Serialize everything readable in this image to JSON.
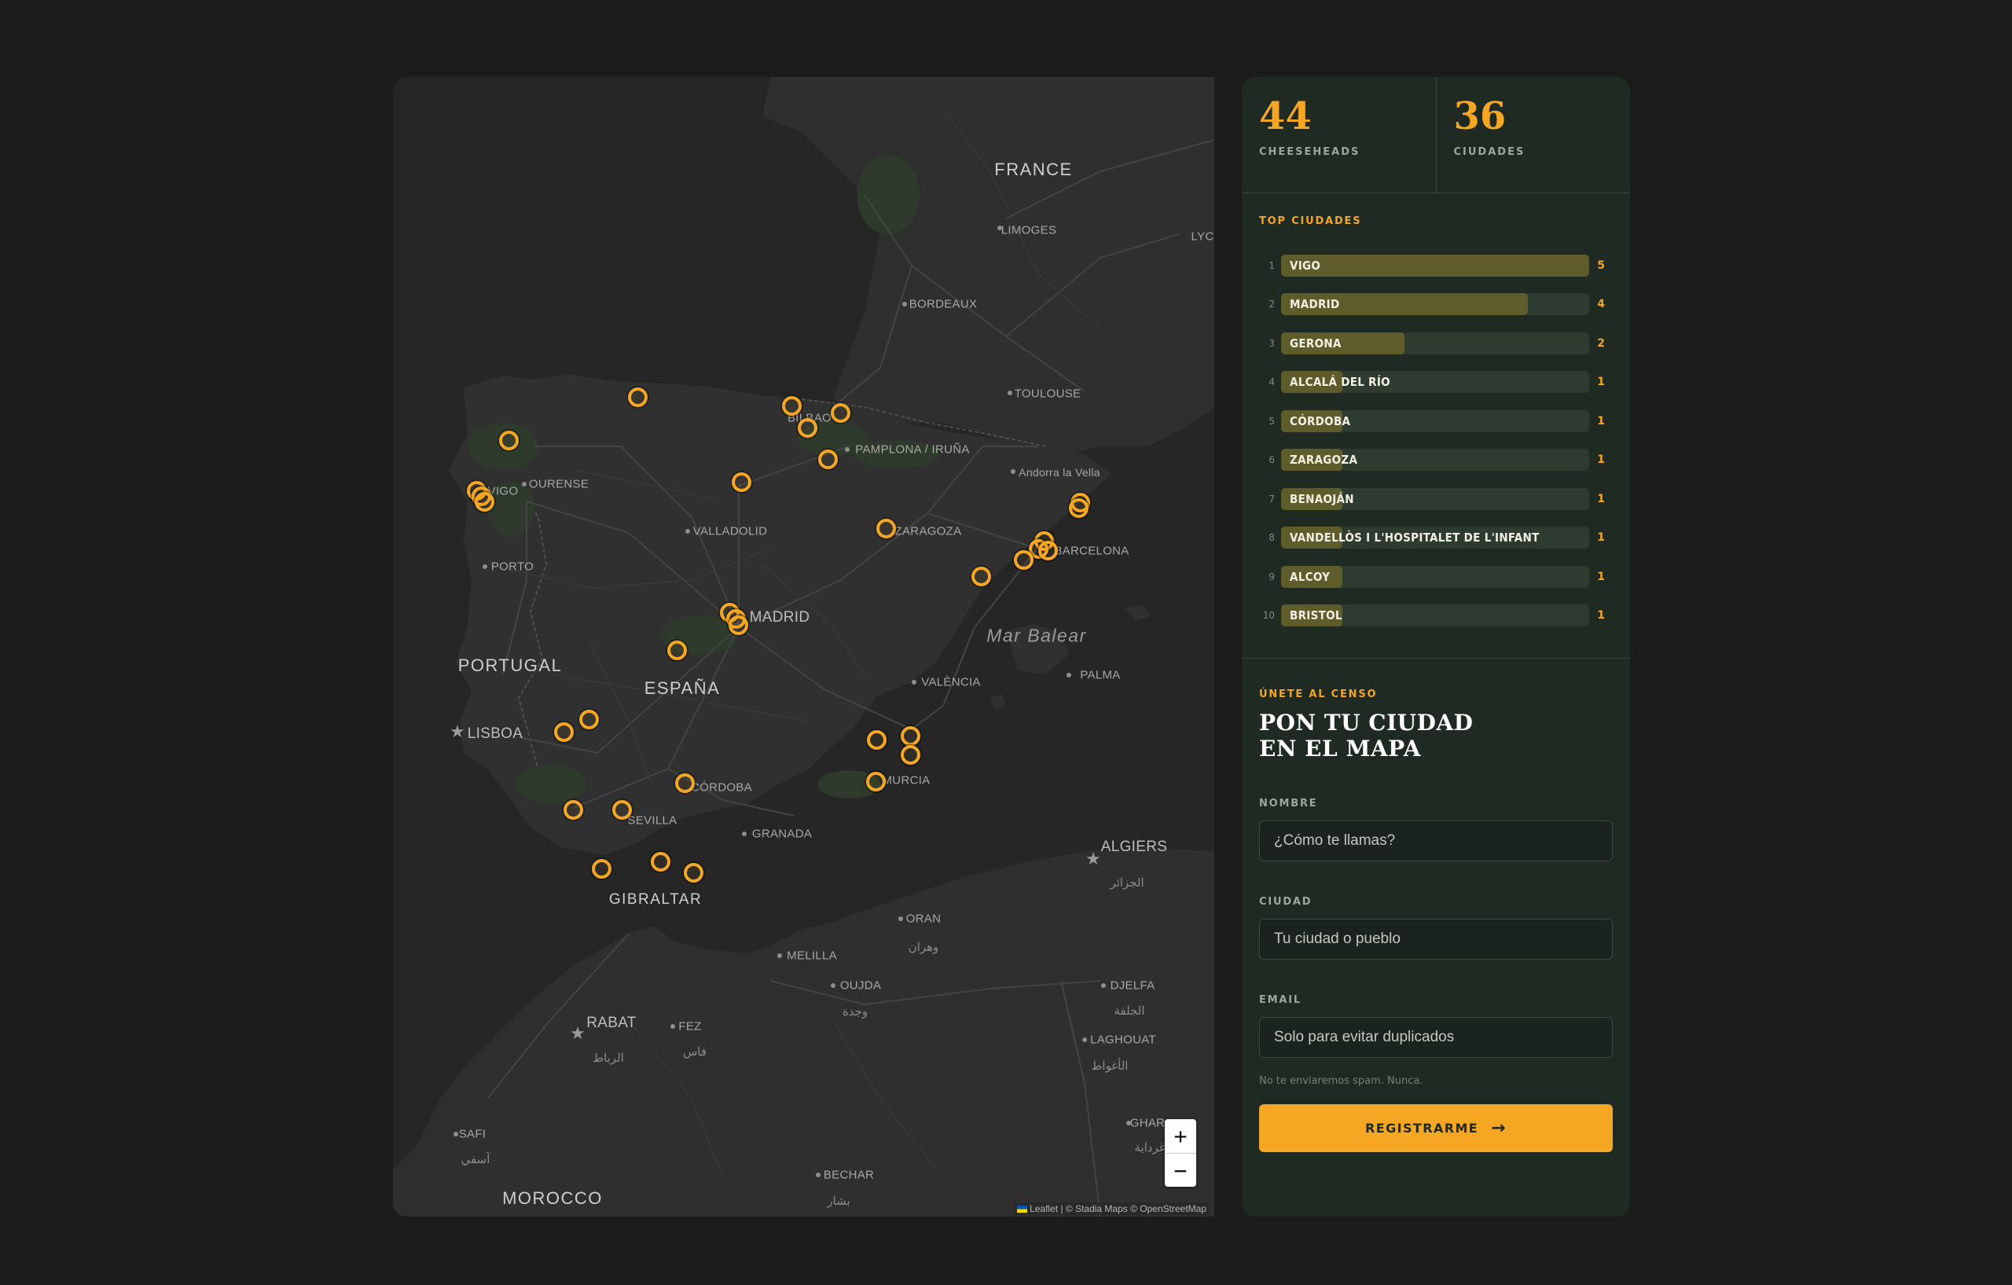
{
  "map": {
    "labels": [
      {
        "name": "label-france",
        "text": "FRANCE",
        "cls": "country"
      },
      {
        "name": "label-espana",
        "text": "ESPAÑA",
        "cls": "country"
      },
      {
        "name": "label-portugal",
        "text": "PORTUGAL",
        "cls": "country"
      },
      {
        "name": "label-morocco",
        "text": "MOROCCO",
        "cls": "country"
      },
      {
        "name": "label-gibraltar",
        "text": "GIBRALTAR",
        "cls": "country"
      },
      {
        "name": "label-mar-balear",
        "text": "Mar Balear",
        "cls": "sea"
      },
      {
        "name": "label-madrid",
        "text": "MADRID",
        "cls": "big"
      },
      {
        "name": "label-lisboa",
        "text": "LISBOA",
        "cls": "big"
      },
      {
        "name": "label-rabat",
        "text": "RABAT",
        "cls": "big"
      },
      {
        "name": "label-rabat-ar",
        "text": "الرباط",
        "cls": "arabic"
      },
      {
        "name": "label-algiers",
        "text": "ALGIERS",
        "cls": "big"
      },
      {
        "name": "label-algiers-ar",
        "text": "الجزائر",
        "cls": "arabic"
      },
      {
        "name": "label-limoges",
        "text": "LIMOGES",
        "cls": ""
      },
      {
        "name": "label-lyon",
        "text": "LYC",
        "cls": ""
      },
      {
        "name": "label-bordeaux",
        "text": "BORDEAUX",
        "cls": ""
      },
      {
        "name": "label-toulouse",
        "text": "TOULOUSE",
        "cls": ""
      },
      {
        "name": "label-bilbao",
        "text": "BILBAO",
        "cls": ""
      },
      {
        "name": "label-pamplona",
        "text": "PAMPLONA / IRUÑA",
        "cls": ""
      },
      {
        "name": "label-andorra",
        "text": "Andorra la Vella",
        "cls": ""
      },
      {
        "name": "label-vigo",
        "text": "VIGO",
        "cls": ""
      },
      {
        "name": "label-ourense",
        "text": "OURENSE",
        "cls": ""
      },
      {
        "name": "label-valladolid",
        "text": "VALLADOLID",
        "cls": ""
      },
      {
        "name": "label-zaragoza",
        "text": "ZARAGOZA",
        "cls": ""
      },
      {
        "name": "label-barcelona",
        "text": "BARCELONA",
        "cls": ""
      },
      {
        "name": "label-porto",
        "text": "PORTO",
        "cls": ""
      },
      {
        "name": "label-valencia",
        "text": "VALÈNCIA",
        "cls": ""
      },
      {
        "name": "label-palma",
        "text": "PALMA",
        "cls": ""
      },
      {
        "name": "label-cordoba",
        "text": "CÓRDOBA",
        "cls": ""
      },
      {
        "name": "label-murcia",
        "text": "MURCIA",
        "cls": ""
      },
      {
        "name": "label-sevilla",
        "text": "SEVILLA",
        "cls": ""
      },
      {
        "name": "label-granada",
        "text": "GRANADA",
        "cls": ""
      },
      {
        "name": "label-oran",
        "text": "ORAN",
        "cls": ""
      },
      {
        "name": "label-oran-ar",
        "text": "وهران",
        "cls": "arabic"
      },
      {
        "name": "label-melilla",
        "text": "MELILLA",
        "cls": ""
      },
      {
        "name": "label-oujda",
        "text": "OUJDA",
        "cls": ""
      },
      {
        "name": "label-oujda-ar",
        "text": "وجدة",
        "cls": "arabic"
      },
      {
        "name": "label-fez",
        "text": "FEZ",
        "cls": ""
      },
      {
        "name": "label-fez-ar",
        "text": "فاس",
        "cls": "arabic"
      },
      {
        "name": "label-djelfa",
        "text": "DJELFA",
        "cls": ""
      },
      {
        "name": "label-djelfa-ar",
        "text": "الجلفة",
        "cls": "arabic"
      },
      {
        "name": "label-laghouat",
        "text": "LAGHOUAT",
        "cls": ""
      },
      {
        "name": "label-laghouat-ar",
        "text": "الأغواط",
        "cls": "arabic"
      },
      {
        "name": "label-safi",
        "text": "SAFI",
        "cls": ""
      },
      {
        "name": "label-safi-ar",
        "text": "آسفي",
        "cls": "arabic"
      },
      {
        "name": "label-bechar",
        "text": "BECHAR",
        "cls": ""
      },
      {
        "name": "label-bechar-ar",
        "text": "بشار",
        "cls": "arabic"
      },
      {
        "name": "label-ghardaia",
        "text": "GHAR",
        "cls": ""
      },
      {
        "name": "label-ghardaia-ar",
        "text": "غرداية",
        "cls": "arabic"
      }
    ],
    "zoom_in": "+",
    "zoom_out": "−",
    "attribution": "Leaflet | © Stadia Maps © OpenStreetMap"
  },
  "stats": [
    {
      "value": "44",
      "label": "CHEESEHEADS"
    },
    {
      "value": "36",
      "label": "CIUDADES"
    }
  ],
  "top": {
    "title": "TOP CIUDADES",
    "max": 5,
    "items": [
      {
        "rank": "1",
        "city": "VIGO",
        "count": 5
      },
      {
        "rank": "2",
        "city": "MADRID",
        "count": 4
      },
      {
        "rank": "3",
        "city": "GERONA",
        "count": 2
      },
      {
        "rank": "4",
        "city": "ALCALÁ DEL RÍO",
        "count": 1
      },
      {
        "rank": "5",
        "city": "CÓRDOBA",
        "count": 1
      },
      {
        "rank": "6",
        "city": "ZARAGOZA",
        "count": 1
      },
      {
        "rank": "7",
        "city": "BENAOJÁN",
        "count": 1
      },
      {
        "rank": "8",
        "city": "VANDELLÒS I L'HOSPITALET DE L'INFANT",
        "count": 1
      },
      {
        "rank": "9",
        "city": "ALCOY",
        "count": 1
      },
      {
        "rank": "10",
        "city": "BRISTOL",
        "count": 1
      }
    ]
  },
  "form": {
    "eyebrow": "ÚNETE AL CENSO",
    "title_line1": "PON TU CIUDAD",
    "title_line2": "EN EL MAPA",
    "name_label": "NOMBRE",
    "name_placeholder": "¿Cómo te llamas?",
    "city_label": "CIUDAD",
    "city_placeholder": "Tu ciudad o pueblo",
    "email_label": "EMAIL",
    "email_placeholder": "Solo para evitar duplicados",
    "hint": "No te enviaremos spam. Nunca.",
    "submit": "REGISTRARME"
  },
  "colors": {
    "accent": "#f5a623",
    "panel": "#1f2a22",
    "map_bg": "#262626",
    "page_bg": "#1c1c1c"
  }
}
